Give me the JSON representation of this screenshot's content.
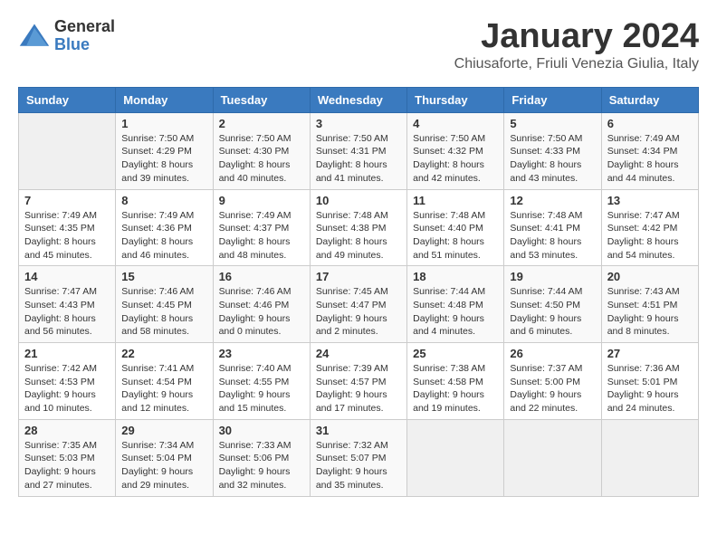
{
  "header": {
    "logo_general": "General",
    "logo_blue": "Blue",
    "month_title": "January 2024",
    "subtitle": "Chiusaforte, Friuli Venezia Giulia, Italy"
  },
  "days_of_week": [
    "Sunday",
    "Monday",
    "Tuesday",
    "Wednesday",
    "Thursday",
    "Friday",
    "Saturday"
  ],
  "weeks": [
    [
      {
        "day": "",
        "sunrise": "",
        "sunset": "",
        "daylight": ""
      },
      {
        "day": "1",
        "sunrise": "Sunrise: 7:50 AM",
        "sunset": "Sunset: 4:29 PM",
        "daylight": "Daylight: 8 hours and 39 minutes."
      },
      {
        "day": "2",
        "sunrise": "Sunrise: 7:50 AM",
        "sunset": "Sunset: 4:30 PM",
        "daylight": "Daylight: 8 hours and 40 minutes."
      },
      {
        "day": "3",
        "sunrise": "Sunrise: 7:50 AM",
        "sunset": "Sunset: 4:31 PM",
        "daylight": "Daylight: 8 hours and 41 minutes."
      },
      {
        "day": "4",
        "sunrise": "Sunrise: 7:50 AM",
        "sunset": "Sunset: 4:32 PM",
        "daylight": "Daylight: 8 hours and 42 minutes."
      },
      {
        "day": "5",
        "sunrise": "Sunrise: 7:50 AM",
        "sunset": "Sunset: 4:33 PM",
        "daylight": "Daylight: 8 hours and 43 minutes."
      },
      {
        "day": "6",
        "sunrise": "Sunrise: 7:49 AM",
        "sunset": "Sunset: 4:34 PM",
        "daylight": "Daylight: 8 hours and 44 minutes."
      }
    ],
    [
      {
        "day": "7",
        "sunrise": "Sunrise: 7:49 AM",
        "sunset": "Sunset: 4:35 PM",
        "daylight": "Daylight: 8 hours and 45 minutes."
      },
      {
        "day": "8",
        "sunrise": "Sunrise: 7:49 AM",
        "sunset": "Sunset: 4:36 PM",
        "daylight": "Daylight: 8 hours and 46 minutes."
      },
      {
        "day": "9",
        "sunrise": "Sunrise: 7:49 AM",
        "sunset": "Sunset: 4:37 PM",
        "daylight": "Daylight: 8 hours and 48 minutes."
      },
      {
        "day": "10",
        "sunrise": "Sunrise: 7:48 AM",
        "sunset": "Sunset: 4:38 PM",
        "daylight": "Daylight: 8 hours and 49 minutes."
      },
      {
        "day": "11",
        "sunrise": "Sunrise: 7:48 AM",
        "sunset": "Sunset: 4:40 PM",
        "daylight": "Daylight: 8 hours and 51 minutes."
      },
      {
        "day": "12",
        "sunrise": "Sunrise: 7:48 AM",
        "sunset": "Sunset: 4:41 PM",
        "daylight": "Daylight: 8 hours and 53 minutes."
      },
      {
        "day": "13",
        "sunrise": "Sunrise: 7:47 AM",
        "sunset": "Sunset: 4:42 PM",
        "daylight": "Daylight: 8 hours and 54 minutes."
      }
    ],
    [
      {
        "day": "14",
        "sunrise": "Sunrise: 7:47 AM",
        "sunset": "Sunset: 4:43 PM",
        "daylight": "Daylight: 8 hours and 56 minutes."
      },
      {
        "day": "15",
        "sunrise": "Sunrise: 7:46 AM",
        "sunset": "Sunset: 4:45 PM",
        "daylight": "Daylight: 8 hours and 58 minutes."
      },
      {
        "day": "16",
        "sunrise": "Sunrise: 7:46 AM",
        "sunset": "Sunset: 4:46 PM",
        "daylight": "Daylight: 9 hours and 0 minutes."
      },
      {
        "day": "17",
        "sunrise": "Sunrise: 7:45 AM",
        "sunset": "Sunset: 4:47 PM",
        "daylight": "Daylight: 9 hours and 2 minutes."
      },
      {
        "day": "18",
        "sunrise": "Sunrise: 7:44 AM",
        "sunset": "Sunset: 4:48 PM",
        "daylight": "Daylight: 9 hours and 4 minutes."
      },
      {
        "day": "19",
        "sunrise": "Sunrise: 7:44 AM",
        "sunset": "Sunset: 4:50 PM",
        "daylight": "Daylight: 9 hours and 6 minutes."
      },
      {
        "day": "20",
        "sunrise": "Sunrise: 7:43 AM",
        "sunset": "Sunset: 4:51 PM",
        "daylight": "Daylight: 9 hours and 8 minutes."
      }
    ],
    [
      {
        "day": "21",
        "sunrise": "Sunrise: 7:42 AM",
        "sunset": "Sunset: 4:53 PM",
        "daylight": "Daylight: 9 hours and 10 minutes."
      },
      {
        "day": "22",
        "sunrise": "Sunrise: 7:41 AM",
        "sunset": "Sunset: 4:54 PM",
        "daylight": "Daylight: 9 hours and 12 minutes."
      },
      {
        "day": "23",
        "sunrise": "Sunrise: 7:40 AM",
        "sunset": "Sunset: 4:55 PM",
        "daylight": "Daylight: 9 hours and 15 minutes."
      },
      {
        "day": "24",
        "sunrise": "Sunrise: 7:39 AM",
        "sunset": "Sunset: 4:57 PM",
        "daylight": "Daylight: 9 hours and 17 minutes."
      },
      {
        "day": "25",
        "sunrise": "Sunrise: 7:38 AM",
        "sunset": "Sunset: 4:58 PM",
        "daylight": "Daylight: 9 hours and 19 minutes."
      },
      {
        "day": "26",
        "sunrise": "Sunrise: 7:37 AM",
        "sunset": "Sunset: 5:00 PM",
        "daylight": "Daylight: 9 hours and 22 minutes."
      },
      {
        "day": "27",
        "sunrise": "Sunrise: 7:36 AM",
        "sunset": "Sunset: 5:01 PM",
        "daylight": "Daylight: 9 hours and 24 minutes."
      }
    ],
    [
      {
        "day": "28",
        "sunrise": "Sunrise: 7:35 AM",
        "sunset": "Sunset: 5:03 PM",
        "daylight": "Daylight: 9 hours and 27 minutes."
      },
      {
        "day": "29",
        "sunrise": "Sunrise: 7:34 AM",
        "sunset": "Sunset: 5:04 PM",
        "daylight": "Daylight: 9 hours and 29 minutes."
      },
      {
        "day": "30",
        "sunrise": "Sunrise: 7:33 AM",
        "sunset": "Sunset: 5:06 PM",
        "daylight": "Daylight: 9 hours and 32 minutes."
      },
      {
        "day": "31",
        "sunrise": "Sunrise: 7:32 AM",
        "sunset": "Sunset: 5:07 PM",
        "daylight": "Daylight: 9 hours and 35 minutes."
      },
      {
        "day": "",
        "sunrise": "",
        "sunset": "",
        "daylight": ""
      },
      {
        "day": "",
        "sunrise": "",
        "sunset": "",
        "daylight": ""
      },
      {
        "day": "",
        "sunrise": "",
        "sunset": "",
        "daylight": ""
      }
    ]
  ]
}
